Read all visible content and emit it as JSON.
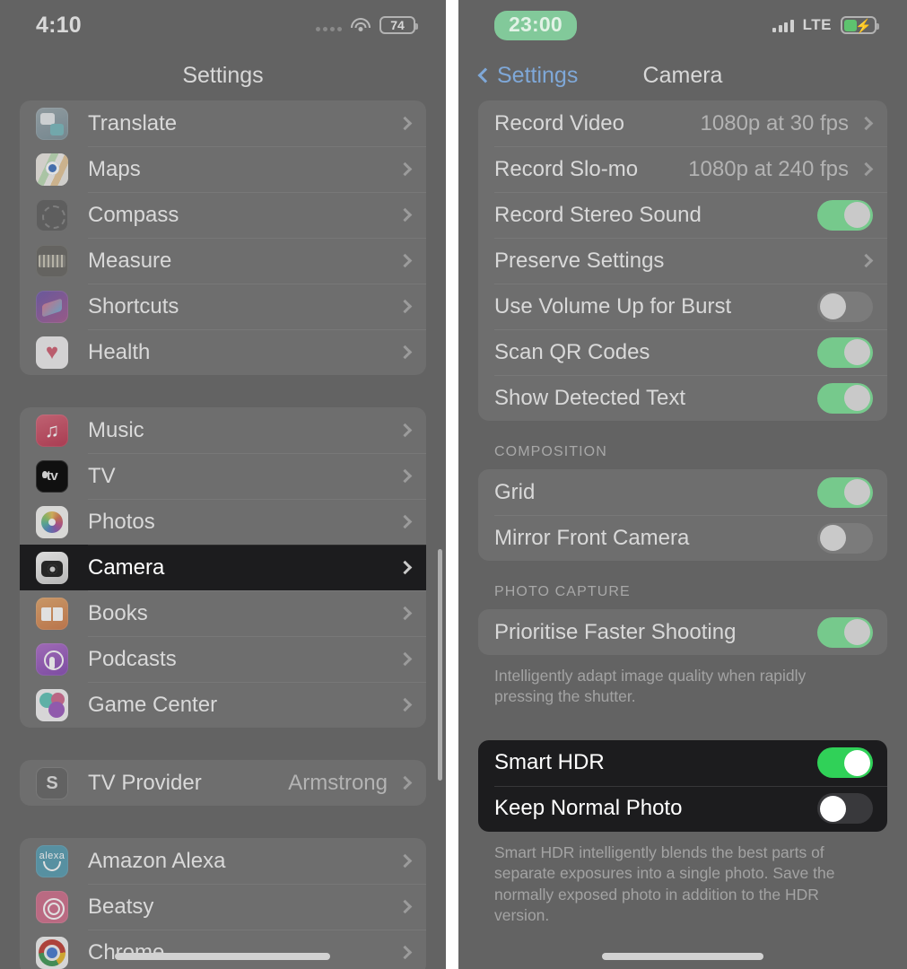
{
  "left_panel": {
    "status_bar": {
      "time": "4:10",
      "battery_level": "74",
      "icons": [
        "signal-dots-icon",
        "wifi-icon",
        "battery-icon"
      ]
    },
    "nav": {
      "title": "Settings"
    },
    "groups": [
      {
        "rows": [
          {
            "label": "Translate",
            "icon": "translate-app-icon",
            "accessory": "chevron"
          },
          {
            "label": "Maps",
            "icon": "maps-app-icon",
            "accessory": "chevron"
          },
          {
            "label": "Compass",
            "icon": "compass-app-icon",
            "accessory": "chevron"
          },
          {
            "label": "Measure",
            "icon": "measure-app-icon",
            "accessory": "chevron"
          },
          {
            "label": "Shortcuts",
            "icon": "shortcuts-app-icon",
            "accessory": "chevron"
          },
          {
            "label": "Health",
            "icon": "health-app-icon",
            "accessory": "chevron"
          }
        ]
      },
      {
        "rows": [
          {
            "label": "Music",
            "icon": "music-app-icon",
            "accessory": "chevron"
          },
          {
            "label": "TV",
            "icon": "tv-app-icon",
            "accessory": "chevron"
          },
          {
            "label": "Photos",
            "icon": "photos-app-icon",
            "accessory": "chevron"
          },
          {
            "label": "Camera",
            "icon": "camera-app-icon",
            "accessory": "chevron",
            "highlighted": true
          },
          {
            "label": "Books",
            "icon": "books-app-icon",
            "accessory": "chevron"
          },
          {
            "label": "Podcasts",
            "icon": "podcasts-app-icon",
            "accessory": "chevron"
          },
          {
            "label": "Game Center",
            "icon": "gamecenter-app-icon",
            "accessory": "chevron"
          }
        ]
      },
      {
        "rows": [
          {
            "label": "TV Provider",
            "icon": "tvprovider-app-icon",
            "value": "Armstrong",
            "accessory": "chevron"
          }
        ]
      },
      {
        "rows": [
          {
            "label": "Amazon Alexa",
            "icon": "alexa-app-icon",
            "accessory": "chevron"
          },
          {
            "label": "Beatsy",
            "icon": "beatsy-app-icon",
            "accessory": "chevron"
          },
          {
            "label": "Chrome",
            "icon": "chrome-app-icon",
            "accessory": "chevron"
          }
        ]
      }
    ]
  },
  "right_panel": {
    "status_bar": {
      "time": "23:00",
      "carrier": "LTE",
      "icons": [
        "signal-bars-icon",
        "lte-label",
        "battery-charging-icon"
      ]
    },
    "nav": {
      "back_label": "Settings",
      "title": "Camera"
    },
    "sections": [
      {
        "header": "",
        "rows": [
          {
            "label": "Record Video",
            "value": "1080p at 30 fps",
            "accessory": "chevron"
          },
          {
            "label": "Record Slo-mo",
            "value": "1080p at 240 fps",
            "accessory": "chevron"
          },
          {
            "label": "Record Stereo Sound",
            "accessory": "toggle",
            "toggle": "on"
          },
          {
            "label": "Preserve Settings",
            "accessory": "chevron"
          },
          {
            "label": "Use Volume Up for Burst",
            "accessory": "toggle",
            "toggle": "off"
          },
          {
            "label": "Scan QR Codes",
            "accessory": "toggle",
            "toggle": "on"
          },
          {
            "label": "Show Detected Text",
            "accessory": "toggle",
            "toggle": "on"
          }
        ],
        "footer": ""
      },
      {
        "header": "COMPOSITION",
        "rows": [
          {
            "label": "Grid",
            "accessory": "toggle",
            "toggle": "on"
          },
          {
            "label": "Mirror Front Camera",
            "accessory": "toggle",
            "toggle": "off"
          }
        ],
        "footer": ""
      },
      {
        "header": "PHOTO CAPTURE",
        "rows": [
          {
            "label": "Prioritise Faster Shooting",
            "accessory": "toggle",
            "toggle": "on"
          }
        ],
        "footer": "Intelligently adapt image quality when rapidly pressing the shutter."
      },
      {
        "header": "",
        "highlighted": true,
        "rows": [
          {
            "label": "Smart HDR",
            "accessory": "toggle",
            "toggle": "on"
          },
          {
            "label": "Keep Normal Photo",
            "accessory": "toggle",
            "toggle": "off"
          }
        ],
        "footer": "Smart HDR intelligently blends the best parts of separate exposures into a single photo. Save the normally exposed photo in addition to the HDR version."
      }
    ]
  },
  "colors": {
    "dim_background": "#636363",
    "card": "#6e6e6e",
    "highlight_background": "#1c1c1e",
    "toggle_on_dimmed": "#76c98c",
    "toggle_on_bright": "#30d158",
    "toggle_off_dimmed": "#7b7b7b",
    "toggle_off_bright": "#39393c",
    "accent_blue": "#7fa8d8",
    "recording_pill_green": "#82c99a"
  }
}
